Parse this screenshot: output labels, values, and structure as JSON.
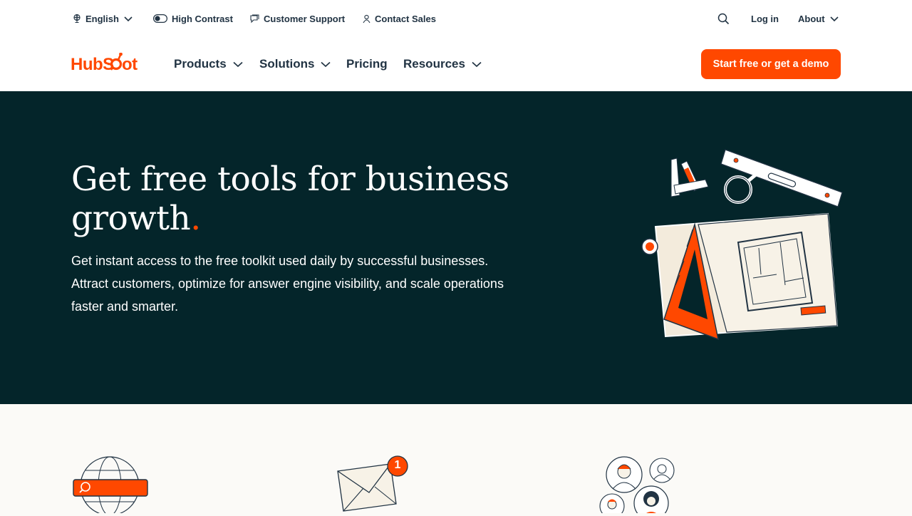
{
  "utility_bar": {
    "language": "English",
    "high_contrast": "High Contrast",
    "customer_support": "Customer Support",
    "contact_sales": "Contact Sales",
    "login": "Log in",
    "about": "About"
  },
  "nav": {
    "logo_text": "HubSpot",
    "items": [
      {
        "label": "Products"
      },
      {
        "label": "Solutions"
      },
      {
        "label": "Pricing"
      },
      {
        "label": "Resources"
      }
    ],
    "cta": "Start free or get a demo"
  },
  "hero": {
    "title": "Get free tools for business growth",
    "title_period": ".",
    "subtitle": "Get instant access to the free toolkit used daily by successful businesses. Attract customers, optimize for answer engine visibility, and scale operations faster and smarter."
  },
  "features": {
    "notification_count": "1"
  },
  "colors": {
    "brand_orange": "#ff4800",
    "hero_background": "#04252a",
    "text_dark": "#213343"
  },
  "icons": [
    "globe-icon",
    "contrast-toggle-icon",
    "chat-icon",
    "person-icon",
    "search-icon",
    "chevron-down-icon"
  ]
}
